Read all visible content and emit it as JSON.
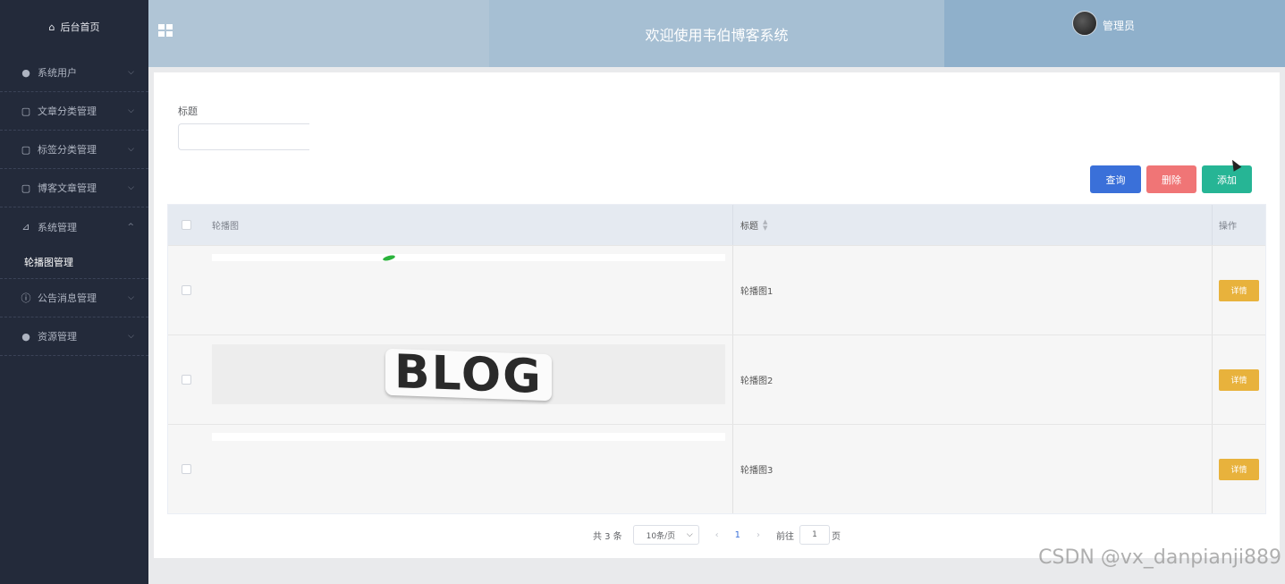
{
  "sidebar": {
    "home": "后台首页",
    "items": [
      {
        "label": "系统用户",
        "icon": "user-icon"
      },
      {
        "label": "文章分类管理",
        "icon": "folder-icon"
      },
      {
        "label": "标签分类管理",
        "icon": "folder-icon"
      },
      {
        "label": "博客文章管理",
        "icon": "folder-icon"
      },
      {
        "label": "系统管理",
        "icon": "chart-icon"
      },
      {
        "label": "公告消息管理",
        "icon": "info-icon"
      },
      {
        "label": "资源管理",
        "icon": "bulb-icon"
      }
    ],
    "submenu": "轮播图管理"
  },
  "header": {
    "title": "欢迎使用韦伯博客系统",
    "username": "管理员"
  },
  "filter": {
    "title_label": "标题",
    "title_value": ""
  },
  "buttons": {
    "query": "查询",
    "delete": "删除",
    "add": "添加"
  },
  "table": {
    "columns": [
      "轮播图",
      "标题",
      "操作"
    ],
    "rows": [
      {
        "title": "轮播图1",
        "action": "详情"
      },
      {
        "title": "轮播图2",
        "action": "详情",
        "image_text": "BLOG"
      },
      {
        "title": "轮播图3",
        "action": "详情"
      }
    ]
  },
  "pagination": {
    "total": "共 3 条",
    "page_size": "10条/页",
    "current_page": "1",
    "jump_label": "前往",
    "jump_value": "1",
    "page_unit": "页"
  },
  "watermark": "CSDN @vx_danpianji889",
  "colors": {
    "sidebar_bg": "#232a3a",
    "query_btn": "#3a70d9",
    "delete_btn": "#f07576",
    "add_btn": "#26b595",
    "detail_btn": "#e8b23c"
  }
}
